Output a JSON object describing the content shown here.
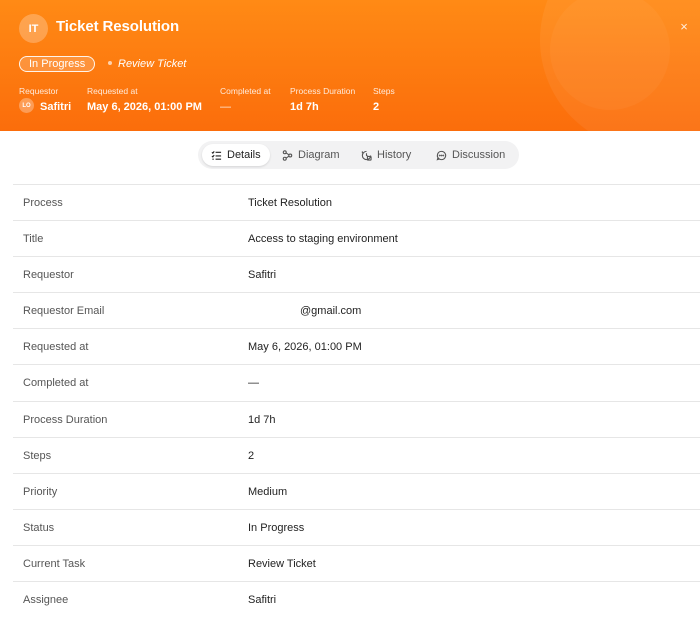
{
  "header": {
    "avatar_initials": "IT",
    "title": "Ticket Resolution",
    "close_glyph": "×",
    "status_badge": "In Progress",
    "current_task": "Review Ticket",
    "meta": {
      "requestor_label": "Requestor",
      "requestor_initials": "LO",
      "requestor_value": "Safitri",
      "requested_at_label": "Requested at",
      "requested_at_value": "May 6, 2026, 01:00 PM",
      "completed_at_label": "Completed at",
      "completed_at_value": "—",
      "duration_label": "Process Duration",
      "duration_value": "1d 7h",
      "steps_label": "Steps",
      "steps_value": "2"
    },
    "colors": {
      "gradient_top": "#ff8a15",
      "gradient_bottom": "#fb6d0b"
    }
  },
  "tabs": [
    {
      "label": "Details",
      "icon": "list-check-icon",
      "active": true
    },
    {
      "label": "Diagram",
      "icon": "diagram-icon",
      "active": false
    },
    {
      "label": "History",
      "icon": "history-icon",
      "active": false
    },
    {
      "label": "Discussion",
      "icon": "chat-icon",
      "active": false
    }
  ],
  "details": [
    {
      "key": "Process",
      "value": "Ticket Resolution"
    },
    {
      "key": "Title",
      "value": "Access to staging environment"
    },
    {
      "key": "Requestor",
      "value": "Safitri"
    },
    {
      "key": "Requestor Email",
      "value": "@gmail.com"
    },
    {
      "key": "Requested at",
      "value": "May 6, 2026, 01:00 PM"
    },
    {
      "key": "Completed at",
      "value": "—"
    },
    {
      "key": "Process Duration",
      "value": "1d 7h"
    },
    {
      "key": "Steps",
      "value": "2"
    },
    {
      "key": "Priority",
      "value": "Medium"
    },
    {
      "key": "Status",
      "value": "In Progress"
    },
    {
      "key": "Current Task",
      "value": "Review Ticket"
    },
    {
      "key": "Assignee",
      "value": "Safitri"
    }
  ]
}
